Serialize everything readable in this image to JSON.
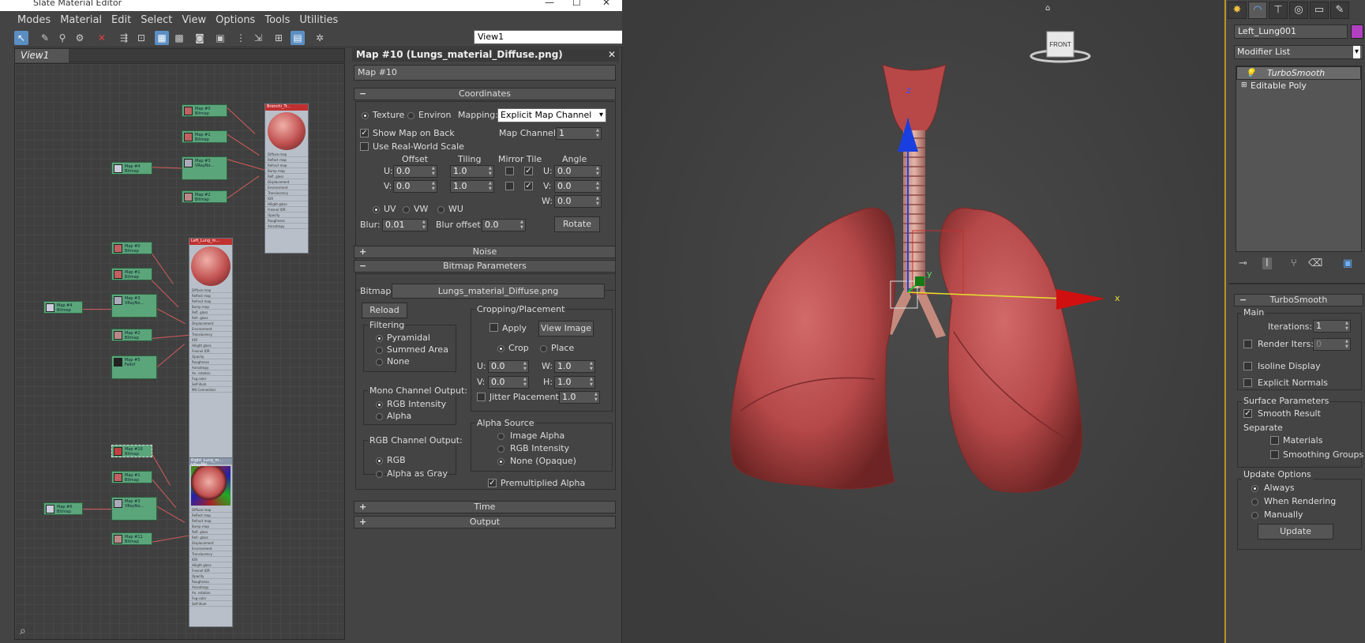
{
  "window": {
    "title": "Slate Material Editor",
    "minimize": "—",
    "maximize": "☐",
    "close": "✕"
  },
  "menu": [
    "Modes",
    "Material",
    "Edit",
    "Select",
    "View",
    "Options",
    "Tools",
    "Utilities"
  ],
  "toolbar": {
    "view_select": "View1"
  },
  "view": {
    "tab": "View1"
  },
  "nodes": {
    "map0": "Map #0\nBitmap",
    "map1": "Map #1\nBitmap",
    "map3": "Map #3\nVRayNo...",
    "map4": "Map #4\nBitmap",
    "map2": "Map #2\nBitmap",
    "map5": "Map #5\nFallof",
    "map10": "Map #10\nBitmap",
    "map6": "Map #6\nBitmap",
    "map11": "Map #11\nBitmap",
    "mat1": "Bronchi_Tr...",
    "mat2": "Left_Lung_m...",
    "mat3": "Right_Lung_m...\nVRayMtl",
    "normal_map": "Normal map",
    "bump_map": "Bump map",
    "mat_conn": "Mtl Connection"
  },
  "map_panel": {
    "title": "Map #10 (Lungs_material_Diffuse.png)",
    "name": "Map #10",
    "coordinates": {
      "header": "Coordinates",
      "texture": "Texture",
      "environ": "Environ",
      "mapping_label": "Mapping:",
      "mapping_value": "Explicit Map Channel",
      "show_map_back": "Show Map on Back",
      "map_channel_label": "Map Channel:",
      "map_channel": "1",
      "real_world": "Use Real-World Scale",
      "offset": "Offset",
      "tiling": "Tiling",
      "mirror_tile": "Mirror Tile",
      "angle": "Angle",
      "u": "U:",
      "v": "V:",
      "w": "W:",
      "off_u": "0.0",
      "off_v": "0.0",
      "til_u": "1.0",
      "til_v": "1.0",
      "ang_u": "0.0",
      "ang_v": "0.0",
      "ang_w": "0.0",
      "uv": "UV",
      "vw": "VW",
      "wu": "WU",
      "blur_label": "Blur:",
      "blur": "0.01",
      "blur_offset_label": "Blur offset:",
      "blur_offset": "0.0",
      "rotate": "Rotate"
    },
    "noise": "Noise",
    "bitmap_params": {
      "header": "Bitmap Parameters",
      "bitmap_label": "Bitmap:",
      "bitmap_file": "Lungs_material_Diffuse.png",
      "reload": "Reload",
      "filtering": "Filtering",
      "pyramidal": "Pyramidal",
      "summed_area": "Summed Area",
      "none": "None",
      "mono_output": "Mono Channel Output:",
      "rgb_intensity": "RGB Intensity",
      "alpha": "Alpha",
      "rgb_output": "RGB Channel Output:",
      "rgb": "RGB",
      "alpha_as_gray": "Alpha as Gray",
      "cropping": "Cropping/Placement",
      "apply": "Apply",
      "view_image": "View Image",
      "crop": "Crop",
      "place": "Place",
      "u": "U:",
      "v": "V:",
      "w": "W:",
      "h": "H:",
      "cu": "0.0",
      "cv": "0.0",
      "cw": "1.0",
      "ch": "1.0",
      "jitter": "Jitter Placement:",
      "jitter_val": "1.0",
      "alpha_source": "Alpha Source",
      "image_alpha": "Image Alpha",
      "rgb_int2": "RGB Intensity",
      "none_opaque": "None (Opaque)",
      "premultiplied": "Premultiplied Alpha"
    },
    "time": "Time",
    "output": "Output",
    "plus": "+",
    "minus": "−"
  },
  "viewport": {
    "cube_label": "FRONT",
    "axis_x": "x",
    "axis_y": "y",
    "axis_z": "z"
  },
  "command_panel": {
    "object_name": "Left_Lung001",
    "modifier_list": "Modifier List",
    "stack": [
      "TurboSmooth",
      "Editable Poly"
    ],
    "turbosmooth": {
      "header": "TurboSmooth",
      "main": "Main",
      "iterations_label": "Iterations:",
      "iterations": "1",
      "render_iters": "Render Iters:",
      "render_iters_val": "0",
      "isoline": "Isoline Display",
      "explicit_normals": "Explicit Normals",
      "surface_params": "Surface Parameters",
      "smooth_result": "Smooth Result",
      "separate": "Separate",
      "materials": "Materials",
      "smoothing_groups": "Smoothing Groups",
      "update_options": "Update Options",
      "always": "Always",
      "when_rendering": "When Rendering",
      "manually": "Manually",
      "update": "Update"
    },
    "color_swatch": "#b040c0"
  }
}
